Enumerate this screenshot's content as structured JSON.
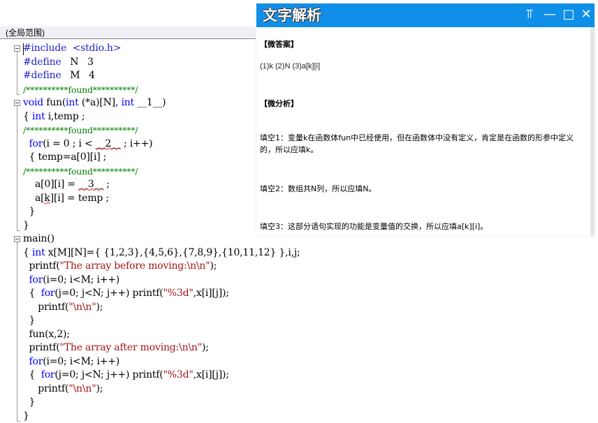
{
  "editor": {
    "scope_label": "(全局范围)",
    "lines": [
      {
        "segments": [
          {
            "t": "#include  <stdio.h>",
            "c": "pp"
          }
        ]
      },
      {
        "segments": [
          {
            "t": "#define   ",
            "c": "pp"
          },
          {
            "t": "N   3",
            "c": ""
          }
        ]
      },
      {
        "segments": [
          {
            "t": "#define   ",
            "c": "pp"
          },
          {
            "t": "M   4",
            "c": ""
          }
        ]
      },
      {
        "segments": [
          {
            "t": "/**********found**********/",
            "c": "cm"
          }
        ]
      },
      {
        "segments": [
          {
            "t": "void",
            "c": "kw"
          },
          {
            "t": " fun(",
            "c": ""
          },
          {
            "t": "int",
            "c": "kw"
          },
          {
            "t": " (*a)[N], ",
            "c": ""
          },
          {
            "t": "int",
            "c": "kw"
          },
          {
            "t": " __1__)",
            "c": ""
          }
        ]
      },
      {
        "segments": [
          {
            "t": "{ ",
            "c": ""
          },
          {
            "t": "int",
            "c": "kw"
          },
          {
            "t": " i,temp ;",
            "c": ""
          }
        ]
      },
      {
        "segments": [
          {
            "t": "/**********found**********/",
            "c": "cm"
          }
        ]
      },
      {
        "segments": [
          {
            "t": "  for",
            "c": "kw"
          },
          {
            "t": "(i = 0 ; i < ",
            "c": ""
          },
          {
            "t": "__2__",
            "c": "squig"
          },
          {
            "t": " ; i++)",
            "c": ""
          }
        ]
      },
      {
        "segments": [
          {
            "t": "  { temp=a[0][i] ;",
            "c": ""
          }
        ]
      },
      {
        "segments": [
          {
            "t": "/**********found**********/",
            "c": "cm"
          }
        ]
      },
      {
        "segments": [
          {
            "t": "    a[0][i] = ",
            "c": ""
          },
          {
            "t": "__3__",
            "c": "squig"
          },
          {
            "t": " ;",
            "c": ""
          }
        ]
      },
      {
        "segments": [
          {
            "t": "    a[",
            "c": ""
          },
          {
            "t": "k",
            "c": "squig"
          },
          {
            "t": "][i] = temp ;",
            "c": ""
          }
        ]
      },
      {
        "segments": [
          {
            "t": "  }",
            "c": ""
          }
        ]
      },
      {
        "segments": [
          {
            "t": "}",
            "c": ""
          }
        ]
      },
      {
        "segments": [
          {
            "t": "main()",
            "c": ""
          }
        ]
      },
      {
        "segments": [
          {
            "t": "{ ",
            "c": ""
          },
          {
            "t": "int",
            "c": "kw"
          },
          {
            "t": " x[M][N]={ {1,2,3},{4,5,6},{7,8,9},{10,11,12} },i,j;",
            "c": ""
          }
        ]
      },
      {
        "segments": [
          {
            "t": "  printf(",
            "c": ""
          },
          {
            "t": "\"The array before moving:\\n\\n\"",
            "c": "str"
          },
          {
            "t": ");",
            "c": ""
          }
        ]
      },
      {
        "segments": [
          {
            "t": "  for",
            "c": "kw"
          },
          {
            "t": "(i=0; i<M; i++)",
            "c": ""
          }
        ]
      },
      {
        "segments": [
          {
            "t": "  {  ",
            "c": ""
          },
          {
            "t": "for",
            "c": "kw"
          },
          {
            "t": "(j=0; j<N; j++) printf(",
            "c": ""
          },
          {
            "t": "\"%3d\"",
            "c": "str"
          },
          {
            "t": ",x[i][j]);",
            "c": ""
          }
        ]
      },
      {
        "segments": [
          {
            "t": "     printf(",
            "c": ""
          },
          {
            "t": "\"\\n\\n\"",
            "c": "str"
          },
          {
            "t": ");",
            "c": ""
          }
        ]
      },
      {
        "segments": [
          {
            "t": "  }",
            "c": ""
          }
        ]
      },
      {
        "segments": [
          {
            "t": "  fun(x,2);",
            "c": ""
          }
        ]
      },
      {
        "segments": [
          {
            "t": "  printf(",
            "c": ""
          },
          {
            "t": "\"The array after moving:\\n\\n\"",
            "c": "str"
          },
          {
            "t": ");",
            "c": ""
          }
        ]
      },
      {
        "segments": [
          {
            "t": "  for",
            "c": "kw"
          },
          {
            "t": "(i=0; i<M; i++)",
            "c": ""
          }
        ]
      },
      {
        "segments": [
          {
            "t": "  {  ",
            "c": ""
          },
          {
            "t": "for",
            "c": "kw"
          },
          {
            "t": "(j=0; j<N; j++) printf(",
            "c": ""
          },
          {
            "t": "\"%3d\"",
            "c": "str"
          },
          {
            "t": ",x[i][j]);",
            "c": ""
          }
        ]
      },
      {
        "segments": [
          {
            "t": "     printf(",
            "c": ""
          },
          {
            "t": "\"\\n\\n\"",
            "c": "str"
          },
          {
            "t": ");",
            "c": ""
          }
        ]
      },
      {
        "segments": [
          {
            "t": "  }",
            "c": ""
          }
        ]
      },
      {
        "segments": [
          {
            "t": "}",
            "c": ""
          }
        ]
      }
    ]
  },
  "panel": {
    "title": "文字解析",
    "icons": {
      "pin": "pin-icon",
      "minimize": "minimize-icon",
      "maximize": "maximize-icon",
      "close": "close-icon"
    },
    "pin_glyph": "⫪",
    "minimize_glyph": "—",
    "maximize_glyph": "□",
    "close_glyph": "✕",
    "answer_heading": "【微答案】",
    "answer_text": "(1)k (2)N (3)a[k][i]",
    "analysis_heading": "【微分析】",
    "blanks": [
      "填空1：变量k在函数体fun中已经使用，但在函数体中没有定义，肯定是在函数的形参中定义的，所以应填k。",
      "填空2：数组共N列，所以应填N。",
      "填空3：这部分语句实现的功能是变量值的交换，所以应填a[k][i]。"
    ]
  }
}
